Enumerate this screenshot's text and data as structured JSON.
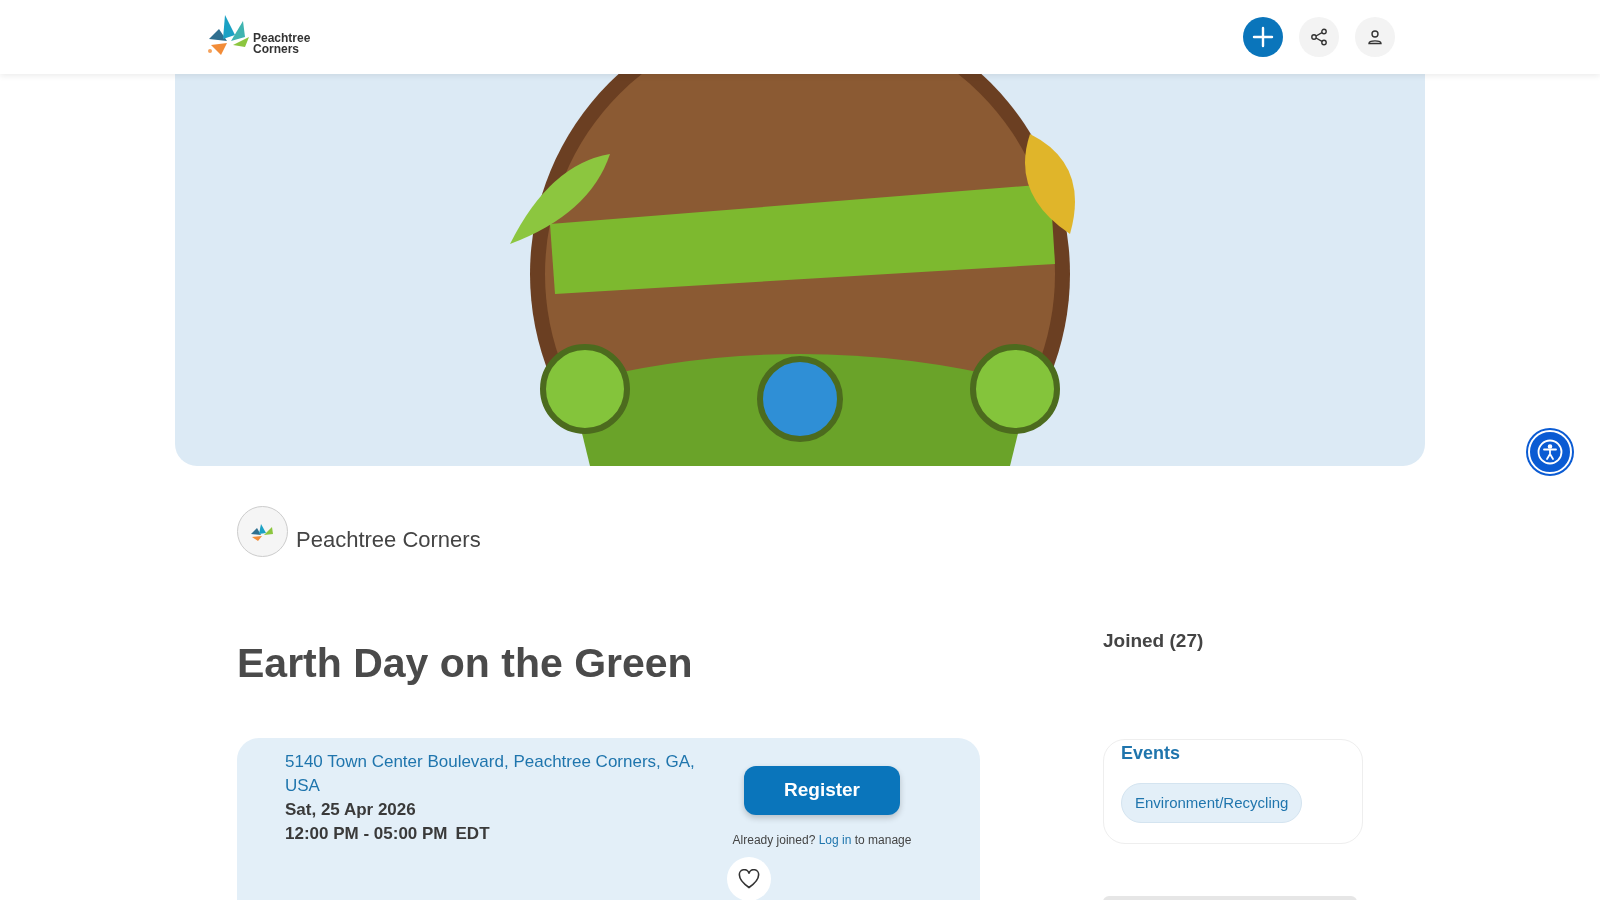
{
  "header": {
    "logo_lines": [
      "Peachtree",
      "Corners"
    ]
  },
  "organizer": {
    "name": "Peachtree Corners"
  },
  "event": {
    "title": "Earth Day on the Green",
    "address": "5140 Town Center Boulevard, Peachtree Corners, GA, USA",
    "date": "Sat, 25 Apr 2026",
    "time": "12:00 PM - 05:00 PM",
    "timezone": "EDT",
    "register": "Register",
    "login_note": {
      "before": "Already joined?",
      "link": "Log in",
      "after": "to manage"
    },
    "favorited": false
  },
  "sidebar": {
    "joined": "Joined (27)",
    "categories": {
      "title": "Events",
      "tags": [
        "Environment/Recycling"
      ]
    }
  }
}
